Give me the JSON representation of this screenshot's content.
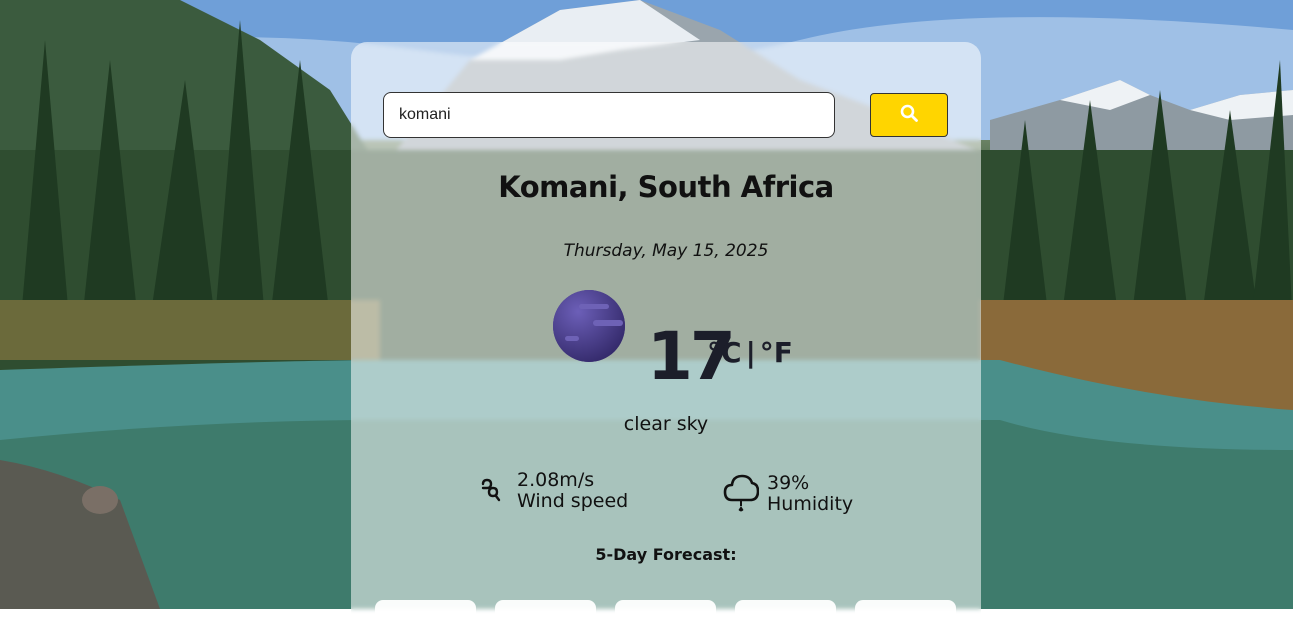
{
  "search": {
    "value": "komani",
    "button_icon": "search-icon"
  },
  "location": {
    "city": "Komani, South Africa",
    "date": "Thursday, May 15, 2025"
  },
  "current": {
    "icon": "moon-clear-night-icon",
    "temperature": "17",
    "unit_celsius": "°C",
    "unit_separator": "|",
    "unit_fahrenheit": "°F",
    "description": "clear sky"
  },
  "stats": {
    "wind": {
      "icon": "wind-icon",
      "value": "2.08m/s",
      "label": "Wind speed"
    },
    "humidity": {
      "icon": "humidity-cloud-icon",
      "value": "39%",
      "label": "Humidity"
    }
  },
  "forecast": {
    "title": "5-Day Forecast:",
    "days": [
      {},
      {},
      {},
      {},
      {}
    ]
  },
  "colors": {
    "search_button": "#ffd500",
    "text": "#111111"
  }
}
